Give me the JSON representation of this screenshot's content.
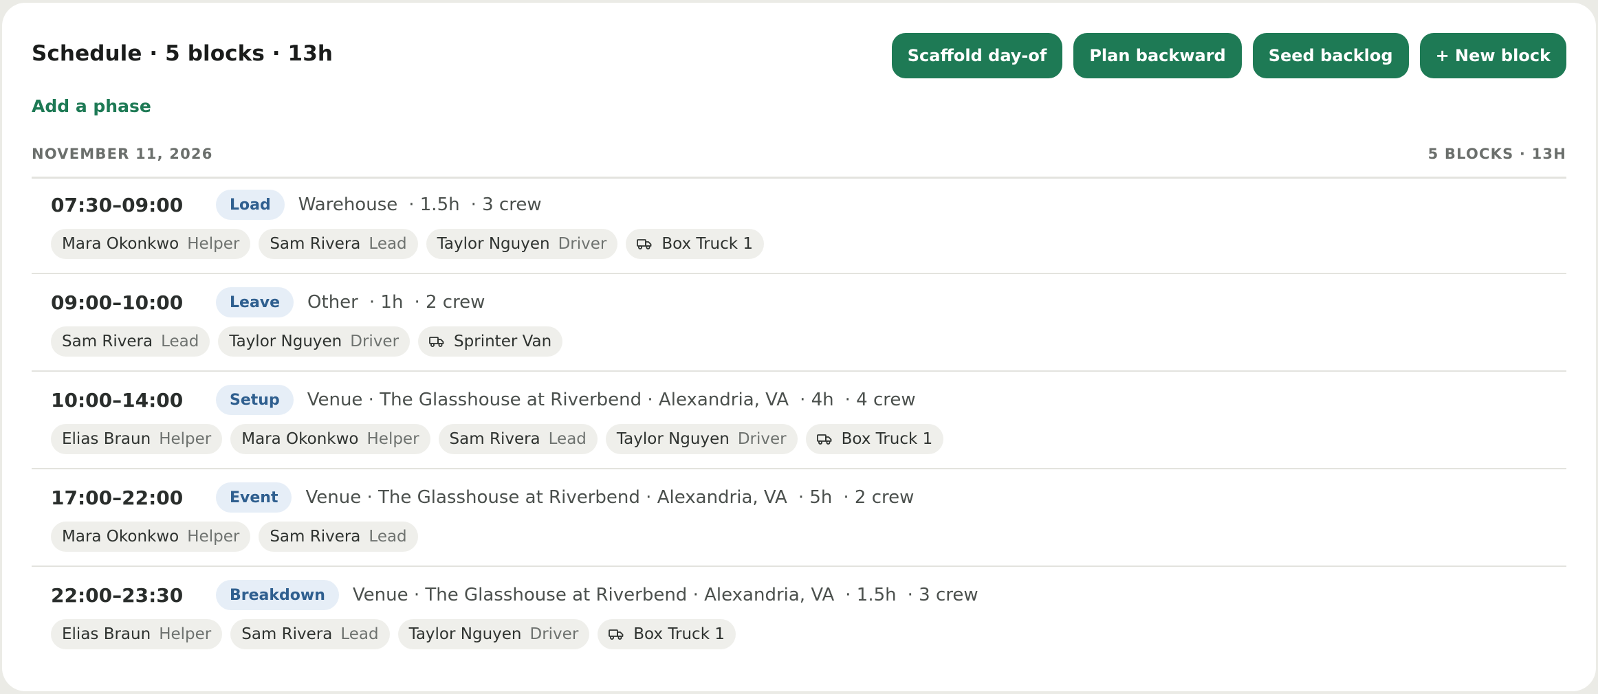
{
  "header": {
    "title": "Schedule · 5 blocks · 13h",
    "add_phase": "Add a phase",
    "buttons": {
      "scaffold": "Scaffold day-of",
      "plan_backward": "Plan backward",
      "seed_backlog": "Seed backlog",
      "new_block": "+ New block"
    }
  },
  "day": {
    "date": "NOVEMBER 11, 2026",
    "summary": "5 BLOCKS · 13H"
  },
  "blocks": [
    {
      "time": "07:30–09:00",
      "phase": "Load",
      "location": "Warehouse",
      "duration": "· 1.5h",
      "crew": "· 3 crew",
      "people": [
        {
          "name": "Mara Okonkwo",
          "role": "Helper"
        },
        {
          "name": "Sam Rivera",
          "role": "Lead"
        },
        {
          "name": "Taylor Nguyen",
          "role": "Driver"
        }
      ],
      "vehicle": "Box Truck 1"
    },
    {
      "time": "09:00–10:00",
      "phase": "Leave",
      "location": "Other",
      "duration": "· 1h",
      "crew": "· 2 crew",
      "people": [
        {
          "name": "Sam Rivera",
          "role": "Lead"
        },
        {
          "name": "Taylor Nguyen",
          "role": "Driver"
        }
      ],
      "vehicle": "Sprinter Van"
    },
    {
      "time": "10:00–14:00",
      "phase": "Setup",
      "location": "Venue · The Glasshouse at Riverbend · Alexandria, VA",
      "duration": "· 4h",
      "crew": "· 4 crew",
      "people": [
        {
          "name": "Elias Braun",
          "role": "Helper"
        },
        {
          "name": "Mara Okonkwo",
          "role": "Helper"
        },
        {
          "name": "Sam Rivera",
          "role": "Lead"
        },
        {
          "name": "Taylor Nguyen",
          "role": "Driver"
        }
      ],
      "vehicle": "Box Truck 1"
    },
    {
      "time": "17:00–22:00",
      "phase": "Event",
      "location": "Venue · The Glasshouse at Riverbend · Alexandria, VA",
      "duration": "· 5h",
      "crew": "· 2 crew",
      "people": [
        {
          "name": "Mara Okonkwo",
          "role": "Helper"
        },
        {
          "name": "Sam Rivera",
          "role": "Lead"
        }
      ],
      "vehicle": null
    },
    {
      "time": "22:00–23:30",
      "phase": "Breakdown",
      "location": "Venue · The Glasshouse at Riverbend · Alexandria, VA",
      "duration": "· 1.5h",
      "crew": "· 3 crew",
      "people": [
        {
          "name": "Elias Braun",
          "role": "Helper"
        },
        {
          "name": "Sam Rivera",
          "role": "Lead"
        },
        {
          "name": "Taylor Nguyen",
          "role": "Driver"
        }
      ],
      "vehicle": "Box Truck 1"
    }
  ],
  "icons": {
    "vehicle": "truck-icon"
  },
  "colors": {
    "accent": "#1e7a55",
    "phase_badge_bg": "#e6eef7",
    "phase_badge_text": "#2f5f8f",
    "chip_bg": "#efefeb"
  }
}
